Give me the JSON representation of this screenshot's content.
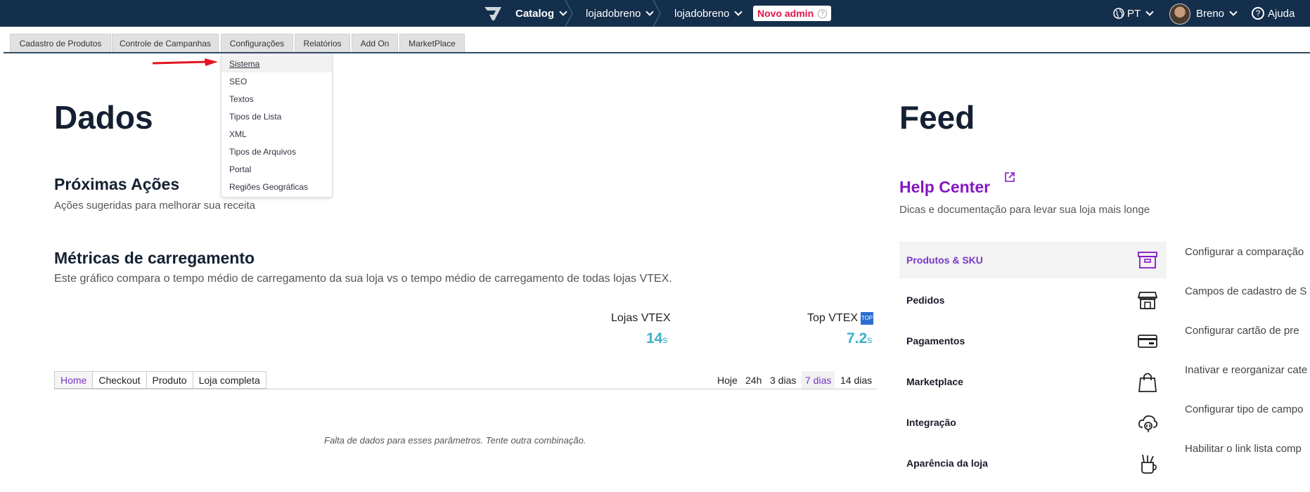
{
  "topbar": {
    "app": "Catalog",
    "account1": "lojadobreno",
    "account2": "lojadobreno",
    "novo_admin": "Novo admin",
    "language": "PT",
    "user": "Breno",
    "help": "Ajuda"
  },
  "menu": {
    "tabs": [
      "Cadastro de Produtos",
      "Controle de Campanhas",
      "Configurações",
      "Relatórios",
      "Add On",
      "MarketPlace"
    ]
  },
  "dropdown": {
    "items": [
      "Sistema",
      "SEO",
      "Textos",
      "Tipos de Lista",
      "XML",
      "Tipos de Arquivos",
      "Portal",
      "Regiões Geográficas"
    ]
  },
  "dados": {
    "title": "Dados",
    "next_title": "Próximas Ações",
    "next_sub": "Ações sugeridas para melhorar sua receita",
    "metrics_title": "Métricas de carregamento",
    "metrics_sub": "Este gráfico compara o tempo médio de carregamento da sua loja vs o tempo médio de carregamento de todas lojas VTEX.",
    "lojas_label": "Lojas VTEX",
    "lojas_value": "14",
    "lojas_unit": "s",
    "top_label": "Top VTEX",
    "top_badge": "TOP",
    "top_value": "7.2",
    "top_unit": "s",
    "page_tabs": [
      "Home",
      "Checkout",
      "Produto",
      "Loja completa"
    ],
    "ranges": [
      "Hoje",
      "24h",
      "3 dias",
      "7 dias",
      "14 dias"
    ],
    "empty": "Falta de dados para esses parâmetros. Tente outra combinação."
  },
  "feed": {
    "title": "Feed",
    "help_title": "Help Center",
    "help_sub": "Dicas e documentação para levar sua loja mais longe",
    "items": [
      {
        "label": "Produtos & SKU",
        "icon": "archive-box-icon"
      },
      {
        "label": "Pedidos",
        "icon": "store-icon"
      },
      {
        "label": "Pagamentos",
        "icon": "credit-card-icon"
      },
      {
        "label": "Marketplace",
        "icon": "shopping-bag-icon"
      },
      {
        "label": "Integração",
        "icon": "cloud-plug-icon"
      },
      {
        "label": "Aparência da loja",
        "icon": "brush-cup-icon"
      }
    ],
    "descriptions": [
      "Configurar a comparação",
      "Campos de cadastro de S",
      "Configurar cartão de pre",
      "Inativar e reorganizar cate",
      "Configurar tipo de campo",
      "Habilitar o link lista comp"
    ]
  },
  "colors": {
    "topbar": "#142f4c",
    "accent_purple": "#8617c4",
    "metric_blue": "#3bb0c9",
    "novo_red": "#e0144c"
  }
}
